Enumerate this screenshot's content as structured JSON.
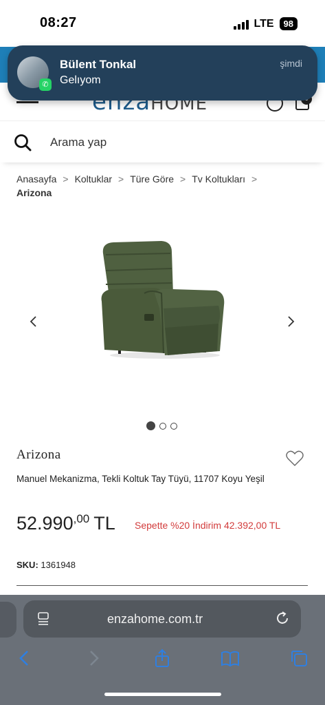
{
  "status": {
    "time": "08:27",
    "network": "LTE",
    "battery": "98"
  },
  "notification": {
    "sender": "Bülent Tonkal",
    "message": "Gelıyom",
    "time": "şimdi",
    "app_icon": "whatsapp-icon"
  },
  "header": {
    "logo_main": "enza",
    "logo_sub": "HOME",
    "cart_count": "0"
  },
  "search": {
    "placeholder": "Arama yap"
  },
  "breadcrumb": {
    "items": [
      "Anasayfa",
      "Koltuklar",
      "Türe Göre",
      "Tv Koltukları"
    ],
    "current": "Arizona",
    "separator": ">"
  },
  "product": {
    "name": "Arizona",
    "description": "Manuel Mekanizma, Tekli Koltuk Tay Tüyü, 11707 Koyu Yeşil",
    "price_main": "52.990",
    "price_decimal": ",00",
    "currency": "TL",
    "discount_text": "Sepette %20 İndirim 42.392,00 TL",
    "sku_label": "SKU:",
    "sku_value": "1361948",
    "image_color": "#4a5a3a"
  },
  "carousel": {
    "total": 3,
    "active": 0
  },
  "browser": {
    "url": "enzahome.com.tr"
  },
  "colors": {
    "header_blue": "#1e7fb8",
    "notification_bg": "#23405a",
    "discount_red": "#d23b3b",
    "toolbar_icon_blue": "#2f7fe0"
  }
}
